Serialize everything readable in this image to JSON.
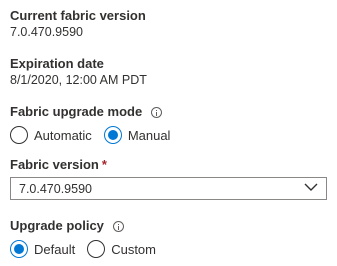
{
  "current_version": {
    "label": "Current fabric version",
    "value": "7.0.470.9590"
  },
  "expiration": {
    "label": "Expiration date",
    "value": "8/1/2020, 12:00 AM PDT"
  },
  "upgrade_mode": {
    "label": "Fabric upgrade mode",
    "options": [
      {
        "label": "Automatic",
        "selected": false
      },
      {
        "label": "Manual",
        "selected": true
      }
    ]
  },
  "fabric_version": {
    "label": "Fabric version",
    "required_marker": "*",
    "selected": "7.0.470.9590"
  },
  "upgrade_policy": {
    "label": "Upgrade policy",
    "options": [
      {
        "label": "Default",
        "selected": true
      },
      {
        "label": "Custom",
        "selected": false
      }
    ]
  },
  "colors": {
    "accent": "#0078d4",
    "text": "#323130",
    "required": "#a4262c",
    "border": "#8a8886"
  }
}
